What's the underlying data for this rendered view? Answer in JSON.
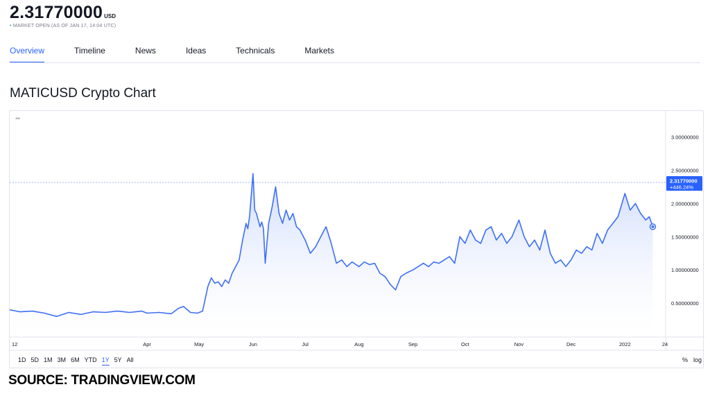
{
  "header": {
    "price": "2.31770000",
    "currency": "USD",
    "status_prefix": "•",
    "status": "MARKET OPEN (AS OF JAN 17, 14:04 UTC)"
  },
  "tabs": [
    "Overview",
    "Timeline",
    "News",
    "Ideas",
    "Technicals",
    "Markets"
  ],
  "active_tab": "Overview",
  "chart_title": "MATICUSD Crypto Chart",
  "chart_menu": "•••",
  "ranges": [
    "1D",
    "5D",
    "1M",
    "3M",
    "6M",
    "YTD",
    "1Y",
    "5Y",
    "All"
  ],
  "active_range": "1Y",
  "scale_toggles": {
    "percent": "%",
    "log": "log"
  },
  "source": "SOURCE: TRADINGVIEW.COM",
  "colors": {
    "line": "#3d6ef5",
    "fill_top": "#c7d6fb",
    "fill_bottom": "#ffffff",
    "accent": "#2962ff",
    "price_label": "#2962ff"
  },
  "chart_data": {
    "type": "area",
    "series": [
      {
        "name": "MATICUSD",
        "points": [
          [
            "2021-01-12",
            0.4
          ],
          [
            "2021-01-18",
            0.37
          ],
          [
            "2021-01-25",
            0.38
          ],
          [
            "2021-02-01",
            0.35
          ],
          [
            "2021-02-08",
            0.3
          ],
          [
            "2021-02-15",
            0.36
          ],
          [
            "2021-02-22",
            0.33
          ],
          [
            "2021-03-01",
            0.37
          ],
          [
            "2021-03-08",
            0.36
          ],
          [
            "2021-03-15",
            0.38
          ],
          [
            "2021-03-22",
            0.36
          ],
          [
            "2021-03-29",
            0.38
          ],
          [
            "2021-04-01",
            0.35
          ],
          [
            "2021-04-08",
            0.36
          ],
          [
            "2021-04-15",
            0.34
          ],
          [
            "2021-04-19",
            0.42
          ],
          [
            "2021-04-22",
            0.45
          ],
          [
            "2021-04-26",
            0.36
          ],
          [
            "2021-04-30",
            0.35
          ],
          [
            "2021-05-03",
            0.38
          ],
          [
            "2021-05-06",
            0.75
          ],
          [
            "2021-05-08",
            0.88
          ],
          [
            "2021-05-10",
            0.8
          ],
          [
            "2021-05-12",
            0.82
          ],
          [
            "2021-05-14",
            0.75
          ],
          [
            "2021-05-16",
            0.85
          ],
          [
            "2021-05-18",
            0.8
          ],
          [
            "2021-05-20",
            0.95
          ],
          [
            "2021-05-22",
            1.05
          ],
          [
            "2021-05-24",
            1.15
          ],
          [
            "2021-05-26",
            1.45
          ],
          [
            "2021-05-28",
            1.7
          ],
          [
            "2021-05-29",
            1.62
          ],
          [
            "2021-05-30",
            1.8
          ],
          [
            "2021-06-01",
            2.45
          ],
          [
            "2021-06-02",
            1.9
          ],
          [
            "2021-06-03",
            1.85
          ],
          [
            "2021-06-05",
            1.65
          ],
          [
            "2021-06-06",
            1.72
          ],
          [
            "2021-06-07",
            1.62
          ],
          [
            "2021-06-08",
            1.1
          ],
          [
            "2021-06-10",
            1.7
          ],
          [
            "2021-06-12",
            1.95
          ],
          [
            "2021-06-14",
            2.25
          ],
          [
            "2021-06-16",
            1.85
          ],
          [
            "2021-06-18",
            1.7
          ],
          [
            "2021-06-20",
            1.9
          ],
          [
            "2021-06-22",
            1.75
          ],
          [
            "2021-06-24",
            1.85
          ],
          [
            "2021-06-26",
            1.65
          ],
          [
            "2021-06-28",
            1.6
          ],
          [
            "2021-07-01",
            1.45
          ],
          [
            "2021-07-04",
            1.25
          ],
          [
            "2021-07-07",
            1.35
          ],
          [
            "2021-07-10",
            1.5
          ],
          [
            "2021-07-13",
            1.65
          ],
          [
            "2021-07-16",
            1.4
          ],
          [
            "2021-07-19",
            1.1
          ],
          [
            "2021-07-22",
            1.15
          ],
          [
            "2021-07-25",
            1.05
          ],
          [
            "2021-07-28",
            1.12
          ],
          [
            "2021-08-01",
            1.05
          ],
          [
            "2021-08-04",
            1.12
          ],
          [
            "2021-08-07",
            1.08
          ],
          [
            "2021-08-10",
            1.1
          ],
          [
            "2021-08-13",
            0.95
          ],
          [
            "2021-08-16",
            0.9
          ],
          [
            "2021-08-19",
            0.78
          ],
          [
            "2021-08-22",
            0.7
          ],
          [
            "2021-08-25",
            0.9
          ],
          [
            "2021-08-28",
            0.95
          ],
          [
            "2021-09-01",
            1.0
          ],
          [
            "2021-09-04",
            1.05
          ],
          [
            "2021-09-07",
            1.1
          ],
          [
            "2021-09-10",
            1.05
          ],
          [
            "2021-09-13",
            1.12
          ],
          [
            "2021-09-16",
            1.1
          ],
          [
            "2021-09-19",
            1.15
          ],
          [
            "2021-09-22",
            1.2
          ],
          [
            "2021-09-25",
            1.1
          ],
          [
            "2021-09-28",
            1.5
          ],
          [
            "2021-10-01",
            1.4
          ],
          [
            "2021-10-04",
            1.6
          ],
          [
            "2021-10-07",
            1.45
          ],
          [
            "2021-10-10",
            1.4
          ],
          [
            "2021-10-13",
            1.6
          ],
          [
            "2021-10-16",
            1.65
          ],
          [
            "2021-10-19",
            1.45
          ],
          [
            "2021-10-22",
            1.55
          ],
          [
            "2021-10-25",
            1.4
          ],
          [
            "2021-10-28",
            1.5
          ],
          [
            "2021-11-01",
            1.75
          ],
          [
            "2021-11-04",
            1.5
          ],
          [
            "2021-11-07",
            1.35
          ],
          [
            "2021-11-10",
            1.45
          ],
          [
            "2021-11-13",
            1.3
          ],
          [
            "2021-11-16",
            1.6
          ],
          [
            "2021-11-19",
            1.25
          ],
          [
            "2021-11-22",
            1.1
          ],
          [
            "2021-11-25",
            1.15
          ],
          [
            "2021-11-28",
            1.05
          ],
          [
            "2021-12-01",
            1.15
          ],
          [
            "2021-12-04",
            1.3
          ],
          [
            "2021-12-07",
            1.25
          ],
          [
            "2021-12-10",
            1.35
          ],
          [
            "2021-12-13",
            1.3
          ],
          [
            "2021-12-16",
            1.55
          ],
          [
            "2021-12-19",
            1.4
          ],
          [
            "2021-12-22",
            1.6
          ],
          [
            "2021-12-25",
            1.7
          ],
          [
            "2021-12-28",
            1.8
          ],
          [
            "2022-01-01",
            2.15
          ],
          [
            "2022-01-04",
            1.9
          ],
          [
            "2022-01-07",
            2.0
          ],
          [
            "2022-01-10",
            1.85
          ],
          [
            "2022-01-13",
            1.75
          ],
          [
            "2022-01-15",
            1.8
          ],
          [
            "2022-01-17",
            1.65
          ]
        ]
      }
    ],
    "y_ticks": [
      "0.50000000",
      "1.00000000",
      "1.50000000",
      "2.00000000",
      "2.50000000",
      "3.00000000"
    ],
    "ylim": [
      0,
      3.1
    ],
    "x_ticks": [
      "12",
      "Apr",
      "May",
      "Jun",
      "Jul",
      "Aug",
      "Sep",
      "Oct",
      "Nov",
      "Dec",
      "2022",
      "24"
    ],
    "last_value_label": "2.31770000",
    "last_change_label": "+446.24%",
    "grid": false,
    "legend": "none"
  }
}
